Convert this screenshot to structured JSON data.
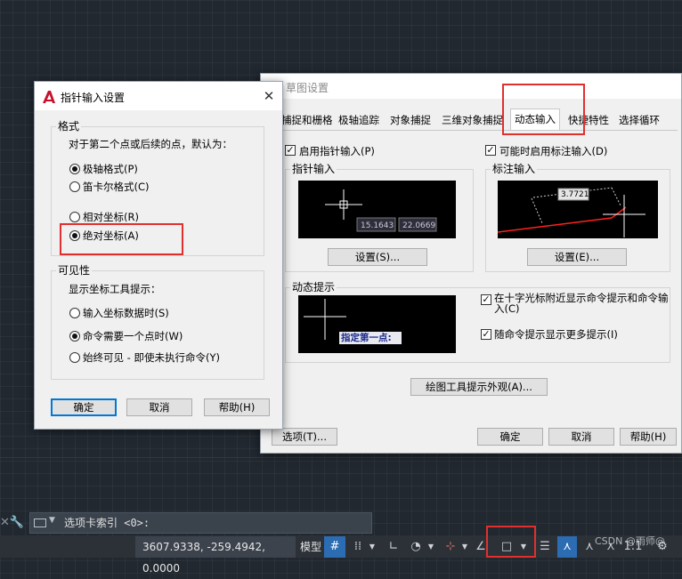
{
  "canvas": {
    "command_line": {
      "text": "选项卡索引 <0>:"
    },
    "status": {
      "coords": "3607.9338, -259.4942, 0.0000",
      "model_label": "模型",
      "watermark": "CSDN @雨师@"
    }
  },
  "pointer_dialog": {
    "title": "指针输入设置",
    "close": "✕",
    "format_group": {
      "label": "格式",
      "description": "对于第二个点或后续的点，默认为：",
      "polar": "极轴格式(P)",
      "cartesian": "笛卡尔格式(C)",
      "relative": "相对坐标(R)",
      "absolute": "绝对坐标(A)"
    },
    "visibility_group": {
      "label": "可见性",
      "description": "显示坐标工具提示：",
      "opt1": "输入坐标数据时(S)",
      "opt2": "命令需要一个点时(W)",
      "opt3": "始终可见 - 即使未执行命令(Y)"
    },
    "buttons": {
      "ok": "确定",
      "cancel": "取消",
      "help": "帮助(H)"
    }
  },
  "drafting_dialog": {
    "title": "草图设置",
    "close": "✕",
    "tabs": [
      "捕捉和栅格",
      "极轴追踪",
      "对象捕捉",
      "三维对象捕捉",
      "动态输入",
      "快捷特性",
      "选择循环"
    ],
    "enable_pointer_input": "启用指针输入(P)",
    "enable_dimension_input": "可能时启用标注输入(D)",
    "pointer_input_group": "指针输入",
    "pointer_preview": {
      "x": "15.1643",
      "y": "22.0669"
    },
    "pointer_settings_button": "设置(S)...",
    "dimension_input_group": "标注输入",
    "dimension_preview": {
      "value": "3.7721"
    },
    "dimension_settings_button": "设置(E)...",
    "dynamic_prompt_group": "动态提示",
    "dynamic_prompt_preview": {
      "prompt": "指定第一点:"
    },
    "show_prompts_near_crosshair": "在十字光标附近显示命令提示和命令输入(C)",
    "show_more_prompts": "随命令提示显示更多提示(I)",
    "drafting_tooltip_button": "绘图工具提示外观(A)...",
    "buttons": {
      "options": "选项(T)...",
      "ok": "确定",
      "cancel": "取消",
      "help": "帮助(H)"
    }
  },
  "colors": {
    "highlight": "#e0302e",
    "grid_background": "#212830",
    "dialog_bg": "#f0f0f0",
    "preview_accent": "#ff2020"
  },
  "icons": [
    "autocad-logo-icon",
    "close-icon",
    "checkbox-checked-icon",
    "radio-selected-icon",
    "wrench-icon",
    "command-line-icon",
    "grid-icon",
    "snap-icon",
    "ortho-icon",
    "polar-icon",
    "osnap-icon",
    "gear-icon"
  ]
}
